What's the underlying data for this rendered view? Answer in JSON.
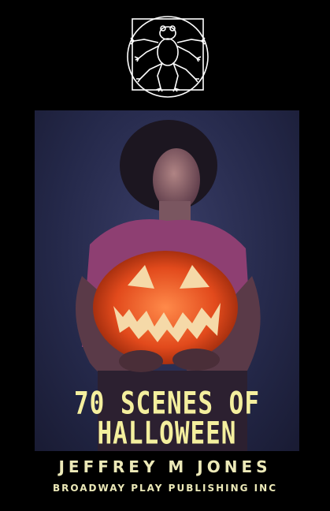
{
  "cover": {
    "title_line1": "70 SCENES OF",
    "title_line2": "HALLOWEEN",
    "author": "JEFFREY M JONES",
    "publisher": "BROADWAY PLAY PUBLISHING INC"
  },
  "colors": {
    "background": "#000000",
    "title_text": "#f4ef9e",
    "byline_text": "#ece9b8",
    "painting_sky": "#242849",
    "pumpkin": "#e24a1c"
  },
  "icons": {
    "logo": "vitruvian-frog-icon"
  }
}
